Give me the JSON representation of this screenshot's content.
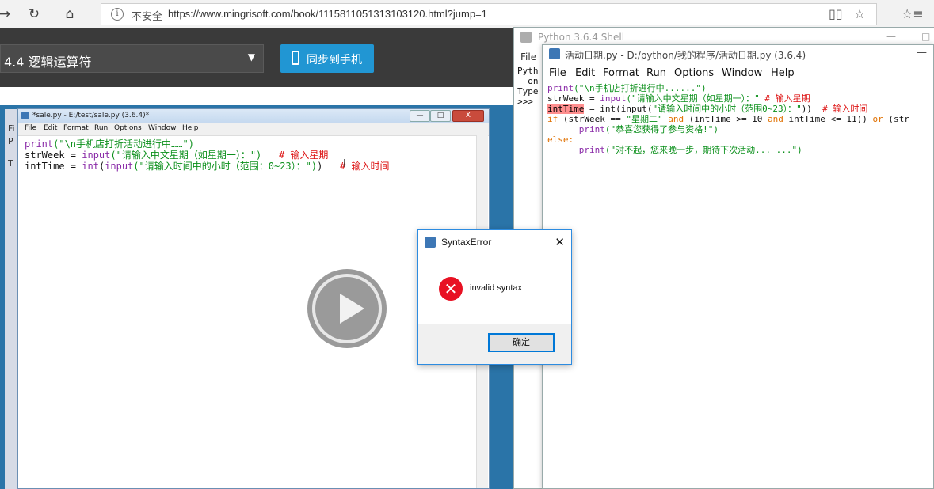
{
  "browser": {
    "back_glyph": "→",
    "reload_glyph": "↻",
    "home_glyph": "⌂",
    "info_glyph": "i",
    "security_label": "不安全",
    "url": "https://www.mingrisoft.com/book/1115811051313103120.html?jump=1",
    "reader_icon": "▯▯",
    "star_icon": "☆",
    "favorites_icon": "☆≡"
  },
  "course": {
    "chapter": "4.4 逻辑运算符",
    "dropdown_caret": "▼",
    "sync_button": "同步到手机"
  },
  "sale_window": {
    "title": "*sale.py - E:/test/sale.py (3.6.4)*",
    "controls": [
      "—",
      "□",
      "X"
    ],
    "menu": [
      "File",
      "Edit",
      "Format",
      "Run",
      "Options",
      "Window",
      "Help"
    ],
    "code_lines": [
      [
        "print",
        "(\"\\n手机店打折活动进行中……\")"
      ],
      [
        "strWeek = ",
        "input",
        "(\"请输入中文星期（如星期一）：\")",
        "   # 输入星期"
      ],
      [
        "intTime = ",
        "int",
        "(",
        "input",
        "(\"请输入时间中的小时（范围：0~23）：\")",
        ")",
        "   # 输入时间"
      ]
    ],
    "cursor_glyph": "I"
  },
  "back_window_marks": [
    "Fi",
    "P",
    "T"
  ],
  "shell_window": {
    "title": "Python 3.6.4 Shell",
    "controls": [
      "—",
      "□"
    ],
    "menu": "File",
    "body": "Pyth\n  on\nType\n>>>"
  },
  "activity_window": {
    "title": "活动日期.py - D:/python/我的程序/活动日期.py (3.6.4)",
    "minimize": "—",
    "menu": [
      "File",
      "Edit",
      "Format",
      "Run",
      "Options",
      "Window",
      "Help"
    ],
    "code": {
      "l1_kw": "print",
      "l1_str": "(\"\\n手机店打折进行中......\")",
      "l2_pre": "strWeek = ",
      "l2_kw": "input",
      "l2_str": "(\"请输入中文星期（如星期一）：\"",
      "l2_post": " # 输入星期",
      "l3_hl": "intTime",
      "l3_mid": " = int(input(",
      "l3_str": "\"请输入时间中的小时（范围0~23）：\"",
      "l3_end": "))",
      "l3_cmt": "  # 输入时间",
      "l4_if": "if",
      "l4_a": " (strWeek == ",
      "l4_str": "\"星期二\"",
      "l4_and": " and",
      "l4_b": " (intTime >= 10 ",
      "l4_and2": "and",
      "l4_c": " intTime <= 11)) ",
      "l4_or": "or",
      "l4_d": " (str",
      "l5_kw": "print",
      "l5_str": "(\"恭喜您获得了参与资格!\")",
      "l6_else": "else:",
      "l7_kw": "print",
      "l7_str": "(\"对不起，您来晚一步，期待下次活动... ...\")"
    }
  },
  "dialog": {
    "title": "SyntaxError",
    "close": "✕",
    "error_glyph": "✕",
    "message": "invalid syntax",
    "ok": "确定"
  },
  "colors": {
    "accent": "#2196d3",
    "error": "#e81123",
    "highlight": "#ff8f8f"
  }
}
